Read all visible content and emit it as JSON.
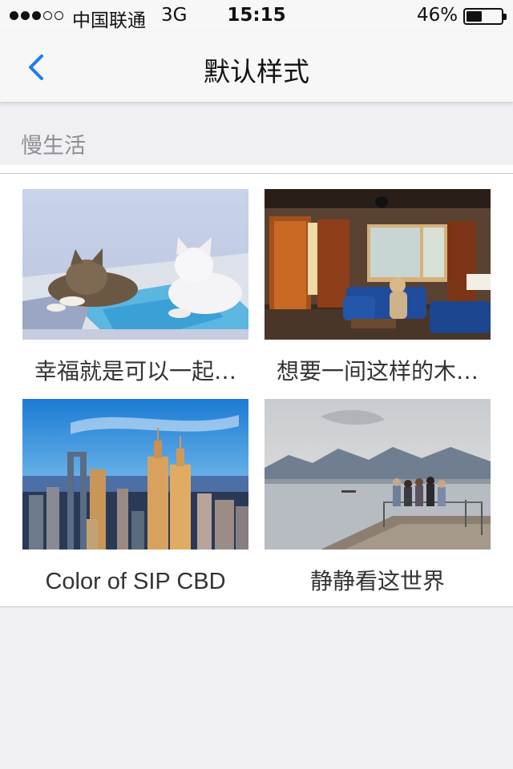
{
  "status_bar": {
    "carrier": "中国联通",
    "network": "3G",
    "time": "15:15",
    "battery_percent": "46%",
    "battery_level": 0.46,
    "signal_strength": 3,
    "signal_max": 5
  },
  "nav": {
    "back_icon": "chevron-left-icon",
    "title": "默认样式",
    "accent_color": "#1a7cf4"
  },
  "section": {
    "header": "慢生活"
  },
  "cards": [
    {
      "caption": "幸福就是可以一起…",
      "image": "two-kittens-on-blanket"
    },
    {
      "caption": "想要一间这样的木…",
      "image": "cabin-living-room-with-blue-sofa"
    },
    {
      "caption": "Color of SIP CBD",
      "image": "city-skyline-at-dusk"
    },
    {
      "caption": "静静看这世界",
      "image": "people-on-lake-pier-with-mountains"
    }
  ]
}
